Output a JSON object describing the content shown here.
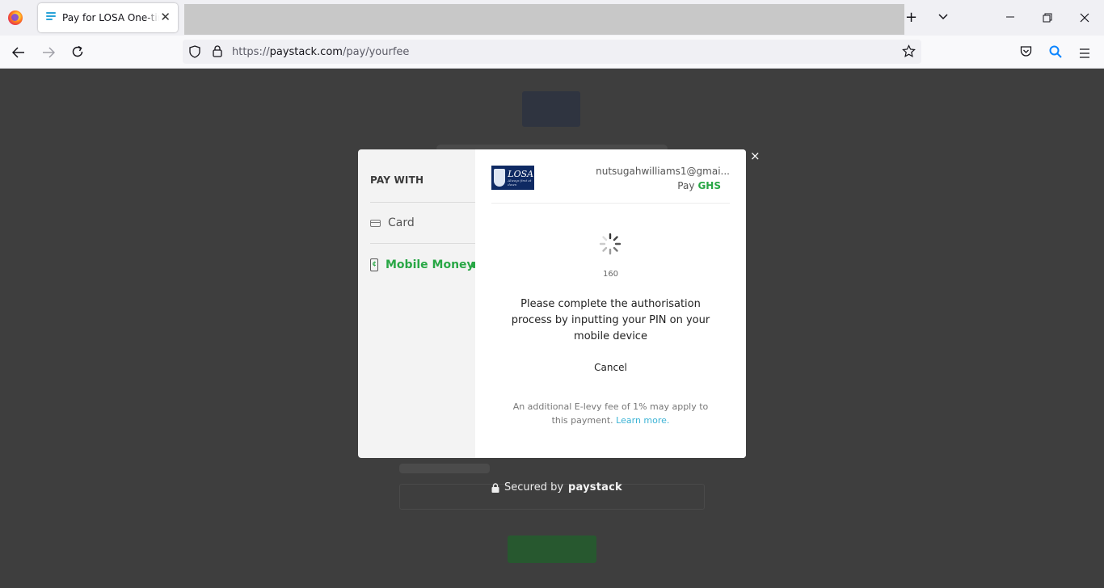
{
  "browser": {
    "tab_title": "Pay for LOSA One-time fee",
    "url_prefix": "https://",
    "url_domain": "paystack.com",
    "url_path": "/pay/yourfee",
    "icons": [
      "firefox-icon",
      "new-tab-icon",
      "tab-list-icon",
      "minimize-icon",
      "restore-icon",
      "close-window-icon",
      "back-icon",
      "forward-icon",
      "reload-icon",
      "shield-icon",
      "lock-icon",
      "bookmark-star-icon",
      "pocket-icon",
      "search-icon",
      "menu-icon"
    ]
  },
  "modal": {
    "pay_with_label": "PAY WITH",
    "methods": [
      {
        "label": "Card",
        "icon": "card-icon",
        "active": false
      },
      {
        "label": "Mobile Money",
        "icon": "phone-icon",
        "active": true
      }
    ],
    "merchant": {
      "name": "LOSA",
      "tagline": "Always first at dawn"
    },
    "email": "nutsugahwilliams1@gmai...",
    "pay_label": "Pay",
    "currency": "GHS",
    "countdown": "160",
    "instruction": "Please complete the authorisation process by inputting your PIN on your mobile device",
    "cancel_label": "Cancel",
    "levy_text": "An additional E-levy fee of 1% may apply to this payment.",
    "learn_more": "Learn more.",
    "close_symbol": "×"
  },
  "footer": {
    "secured_by": "Secured by",
    "brand": "paystack"
  },
  "colors": {
    "accent_green": "#28a745",
    "link_blue": "#3bb3d5",
    "overlay": "#3e3e3e"
  }
}
